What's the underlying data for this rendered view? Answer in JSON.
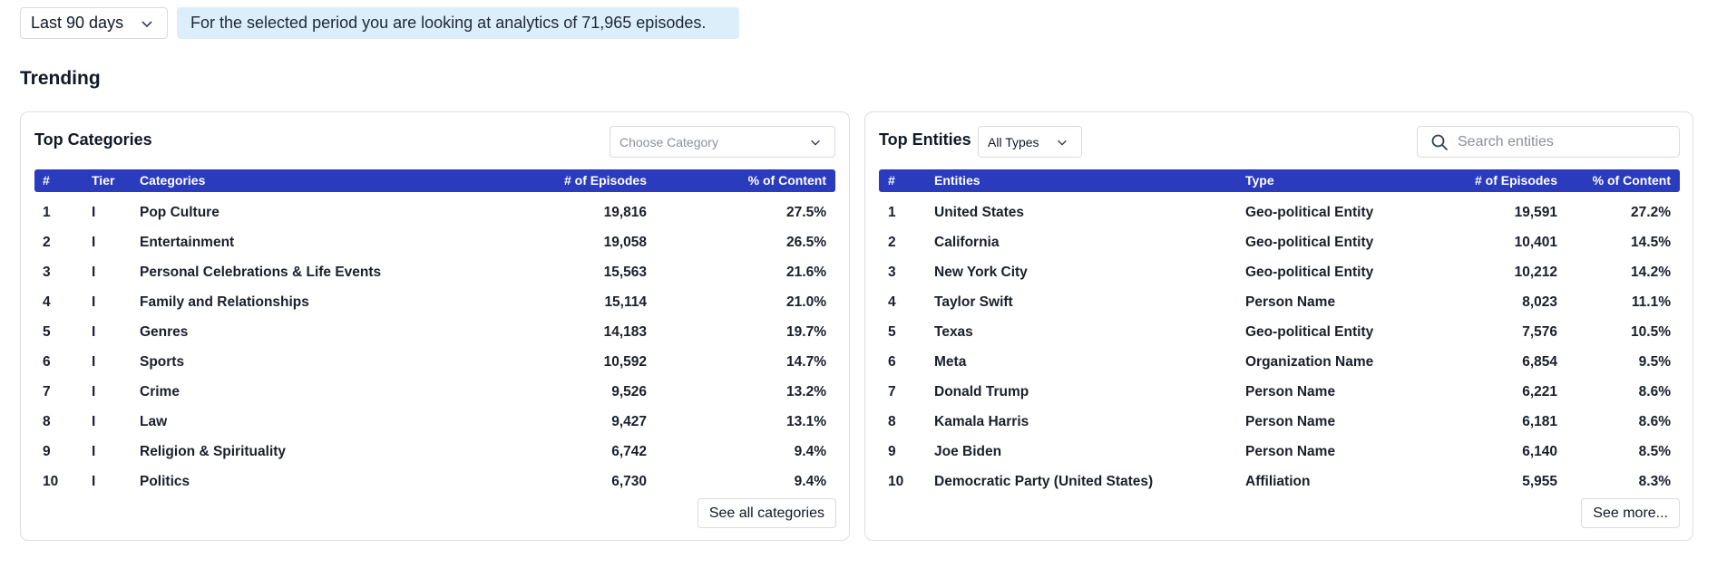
{
  "filters": {
    "period": "Last 90 days",
    "info_banner": "For the selected period you are looking at analytics of 71,965 episodes."
  },
  "section_title": "Trending",
  "colors": {
    "table_header": "#2a3bbd",
    "banner_bg": "#dbeef9"
  },
  "categories": {
    "title": "Top Categories",
    "select_placeholder": "Choose Category",
    "columns": [
      "#",
      "Tier",
      "Categories",
      "# of Episodes",
      "% of Content"
    ],
    "rows": [
      {
        "rank": "1",
        "tier": "I",
        "name": "Pop Culture",
        "episodes": "19,816",
        "percent": "27.5%"
      },
      {
        "rank": "2",
        "tier": "I",
        "name": "Entertainment",
        "episodes": "19,058",
        "percent": "26.5%"
      },
      {
        "rank": "3",
        "tier": "I",
        "name": "Personal Celebrations & Life Events",
        "episodes": "15,563",
        "percent": "21.6%"
      },
      {
        "rank": "4",
        "tier": "I",
        "name": "Family and Relationships",
        "episodes": "15,114",
        "percent": "21.0%"
      },
      {
        "rank": "5",
        "tier": "I",
        "name": "Genres",
        "episodes": "14,183",
        "percent": "19.7%"
      },
      {
        "rank": "6",
        "tier": "I",
        "name": "Sports",
        "episodes": "10,592",
        "percent": "14.7%"
      },
      {
        "rank": "7",
        "tier": "I",
        "name": "Crime",
        "episodes": "9,526",
        "percent": "13.2%"
      },
      {
        "rank": "8",
        "tier": "I",
        "name": "Law",
        "episodes": "9,427",
        "percent": "13.1%"
      },
      {
        "rank": "9",
        "tier": "I",
        "name": "Religion & Spirituality",
        "episodes": "6,742",
        "percent": "9.4%"
      },
      {
        "rank": "10",
        "tier": "I",
        "name": "Politics",
        "episodes": "6,730",
        "percent": "9.4%"
      }
    ],
    "footer_button": "See all categories"
  },
  "entities": {
    "title": "Top Entities",
    "type_select": "All Types",
    "search_placeholder": "Search entities",
    "columns": [
      "#",
      "Entities",
      "Type",
      "# of Episodes",
      "% of Content"
    ],
    "rows": [
      {
        "rank": "1",
        "name": "United States",
        "type": "Geo-political Entity",
        "episodes": "19,591",
        "percent": "27.2%"
      },
      {
        "rank": "2",
        "name": "California",
        "type": "Geo-political Entity",
        "episodes": "10,401",
        "percent": "14.5%"
      },
      {
        "rank": "3",
        "name": "New York City",
        "type": "Geo-political Entity",
        "episodes": "10,212",
        "percent": "14.2%"
      },
      {
        "rank": "4",
        "name": "Taylor Swift",
        "type": "Person Name",
        "episodes": "8,023",
        "percent": "11.1%"
      },
      {
        "rank": "5",
        "name": "Texas",
        "type": "Geo-political Entity",
        "episodes": "7,576",
        "percent": "10.5%"
      },
      {
        "rank": "6",
        "name": "Meta",
        "type": "Organization Name",
        "episodes": "6,854",
        "percent": "9.5%"
      },
      {
        "rank": "7",
        "name": "Donald Trump",
        "type": "Person Name",
        "episodes": "6,221",
        "percent": "8.6%"
      },
      {
        "rank": "8",
        "name": "Kamala Harris",
        "type": "Person Name",
        "episodes": "6,181",
        "percent": "8.6%"
      },
      {
        "rank": "9",
        "name": "Joe Biden",
        "type": "Person Name",
        "episodes": "6,140",
        "percent": "8.5%"
      },
      {
        "rank": "10",
        "name": "Democratic Party (United States)",
        "type": "Affiliation",
        "episodes": "5,955",
        "percent": "8.3%"
      }
    ],
    "footer_button": "See more..."
  }
}
